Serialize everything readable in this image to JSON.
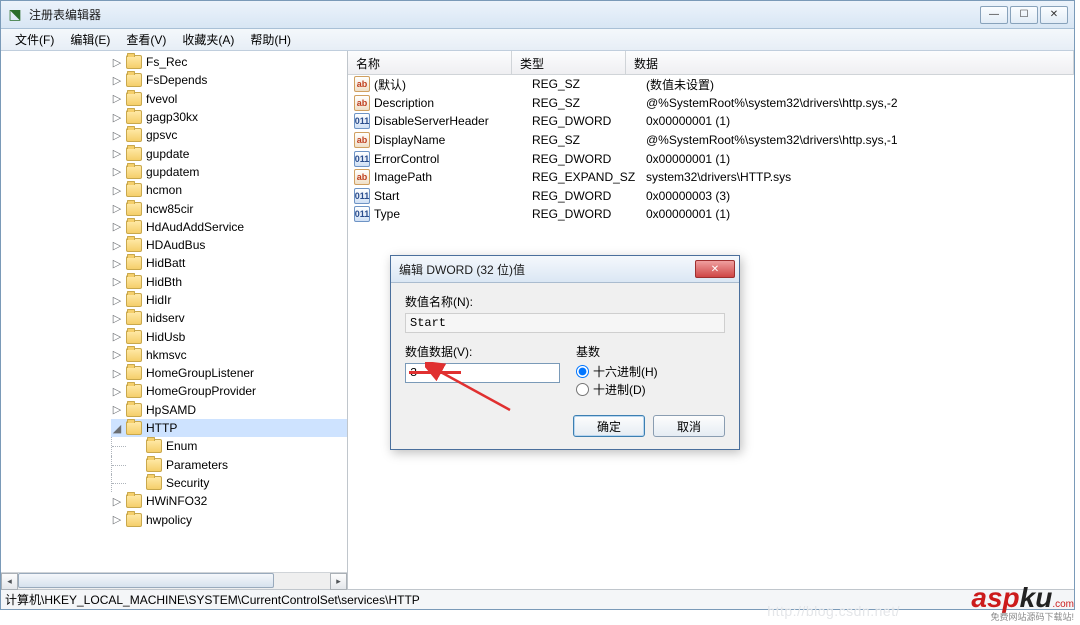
{
  "window": {
    "title": "注册表编辑器",
    "min": "—",
    "max": "☐",
    "close": "✕"
  },
  "menu": [
    "文件(F)",
    "编辑(E)",
    "查看(V)",
    "收藏夹(A)",
    "帮助(H)"
  ],
  "tree_items": [
    {
      "label": "Fs_Rec",
      "depth": 0,
      "exp": "▷"
    },
    {
      "label": "FsDepends",
      "depth": 0,
      "exp": "▷"
    },
    {
      "label": "fvevol",
      "depth": 0,
      "exp": "▷"
    },
    {
      "label": "gagp30kx",
      "depth": 0,
      "exp": "▷"
    },
    {
      "label": "gpsvc",
      "depth": 0,
      "exp": "▷"
    },
    {
      "label": "gupdate",
      "depth": 0,
      "exp": "▷"
    },
    {
      "label": "gupdatem",
      "depth": 0,
      "exp": "▷"
    },
    {
      "label": "hcmon",
      "depth": 0,
      "exp": "▷"
    },
    {
      "label": "hcw85cir",
      "depth": 0,
      "exp": "▷"
    },
    {
      "label": "HdAudAddService",
      "depth": 0,
      "exp": "▷"
    },
    {
      "label": "HDAudBus",
      "depth": 0,
      "exp": "▷"
    },
    {
      "label": "HidBatt",
      "depth": 0,
      "exp": "▷"
    },
    {
      "label": "HidBth",
      "depth": 0,
      "exp": "▷"
    },
    {
      "label": "HidIr",
      "depth": 0,
      "exp": "▷"
    },
    {
      "label": "hidserv",
      "depth": 0,
      "exp": "▷"
    },
    {
      "label": "HidUsb",
      "depth": 0,
      "exp": "▷"
    },
    {
      "label": "hkmsvc",
      "depth": 0,
      "exp": "▷"
    },
    {
      "label": "HomeGroupListener",
      "depth": 0,
      "exp": "▷"
    },
    {
      "label": "HomeGroupProvider",
      "depth": 0,
      "exp": "▷"
    },
    {
      "label": "HpSAMD",
      "depth": 0,
      "exp": "▷"
    },
    {
      "label": "HTTP",
      "depth": 0,
      "exp": "◢",
      "selected": true
    },
    {
      "label": "Enum",
      "depth": 1,
      "exp": ""
    },
    {
      "label": "Parameters",
      "depth": 1,
      "exp": ""
    },
    {
      "label": "Security",
      "depth": 1,
      "exp": ""
    },
    {
      "label": "HWiNFO32",
      "depth": 0,
      "exp": "▷"
    },
    {
      "label": "hwpolicy",
      "depth": 0,
      "exp": "▷"
    }
  ],
  "list_header": {
    "name": "名称",
    "type": "类型",
    "data": "数据"
  },
  "list_rows": [
    {
      "icon": "sz",
      "name": "(默认)",
      "type": "REG_SZ",
      "data": "(数值未设置)"
    },
    {
      "icon": "sz",
      "name": "Description",
      "type": "REG_SZ",
      "data": "@%SystemRoot%\\system32\\drivers\\http.sys,-2"
    },
    {
      "icon": "dw",
      "name": "DisableServerHeader",
      "type": "REG_DWORD",
      "data": "0x00000001 (1)"
    },
    {
      "icon": "sz",
      "name": "DisplayName",
      "type": "REG_SZ",
      "data": "@%SystemRoot%\\system32\\drivers\\http.sys,-1"
    },
    {
      "icon": "dw",
      "name": "ErrorControl",
      "type": "REG_DWORD",
      "data": "0x00000001 (1)"
    },
    {
      "icon": "sz",
      "name": "ImagePath",
      "type": "REG_EXPAND_SZ",
      "data": "system32\\drivers\\HTTP.sys"
    },
    {
      "icon": "dw",
      "name": "Start",
      "type": "REG_DWORD",
      "data": "0x00000003 (3)"
    },
    {
      "icon": "dw",
      "name": "Type",
      "type": "REG_DWORD",
      "data": "0x00000001 (1)"
    }
  ],
  "statusbar": "计算机\\HKEY_LOCAL_MACHINE\\SYSTEM\\CurrentControlSet\\services\\HTTP",
  "dialog": {
    "title": "编辑 DWORD (32 位)值",
    "name_label": "数值名称(N):",
    "name_value": "Start",
    "data_label": "数值数据(V):",
    "data_value": "3",
    "base_label": "基数",
    "radio_hex": "十六进制(H)",
    "radio_dec": "十进制(D)",
    "ok": "确定",
    "cancel": "取消"
  },
  "watermark_url": "http://blog.csdn.net/",
  "brand": {
    "a": "asp",
    "b": "ku",
    "c": ".com",
    "d": "免费网站源码下载站!"
  }
}
